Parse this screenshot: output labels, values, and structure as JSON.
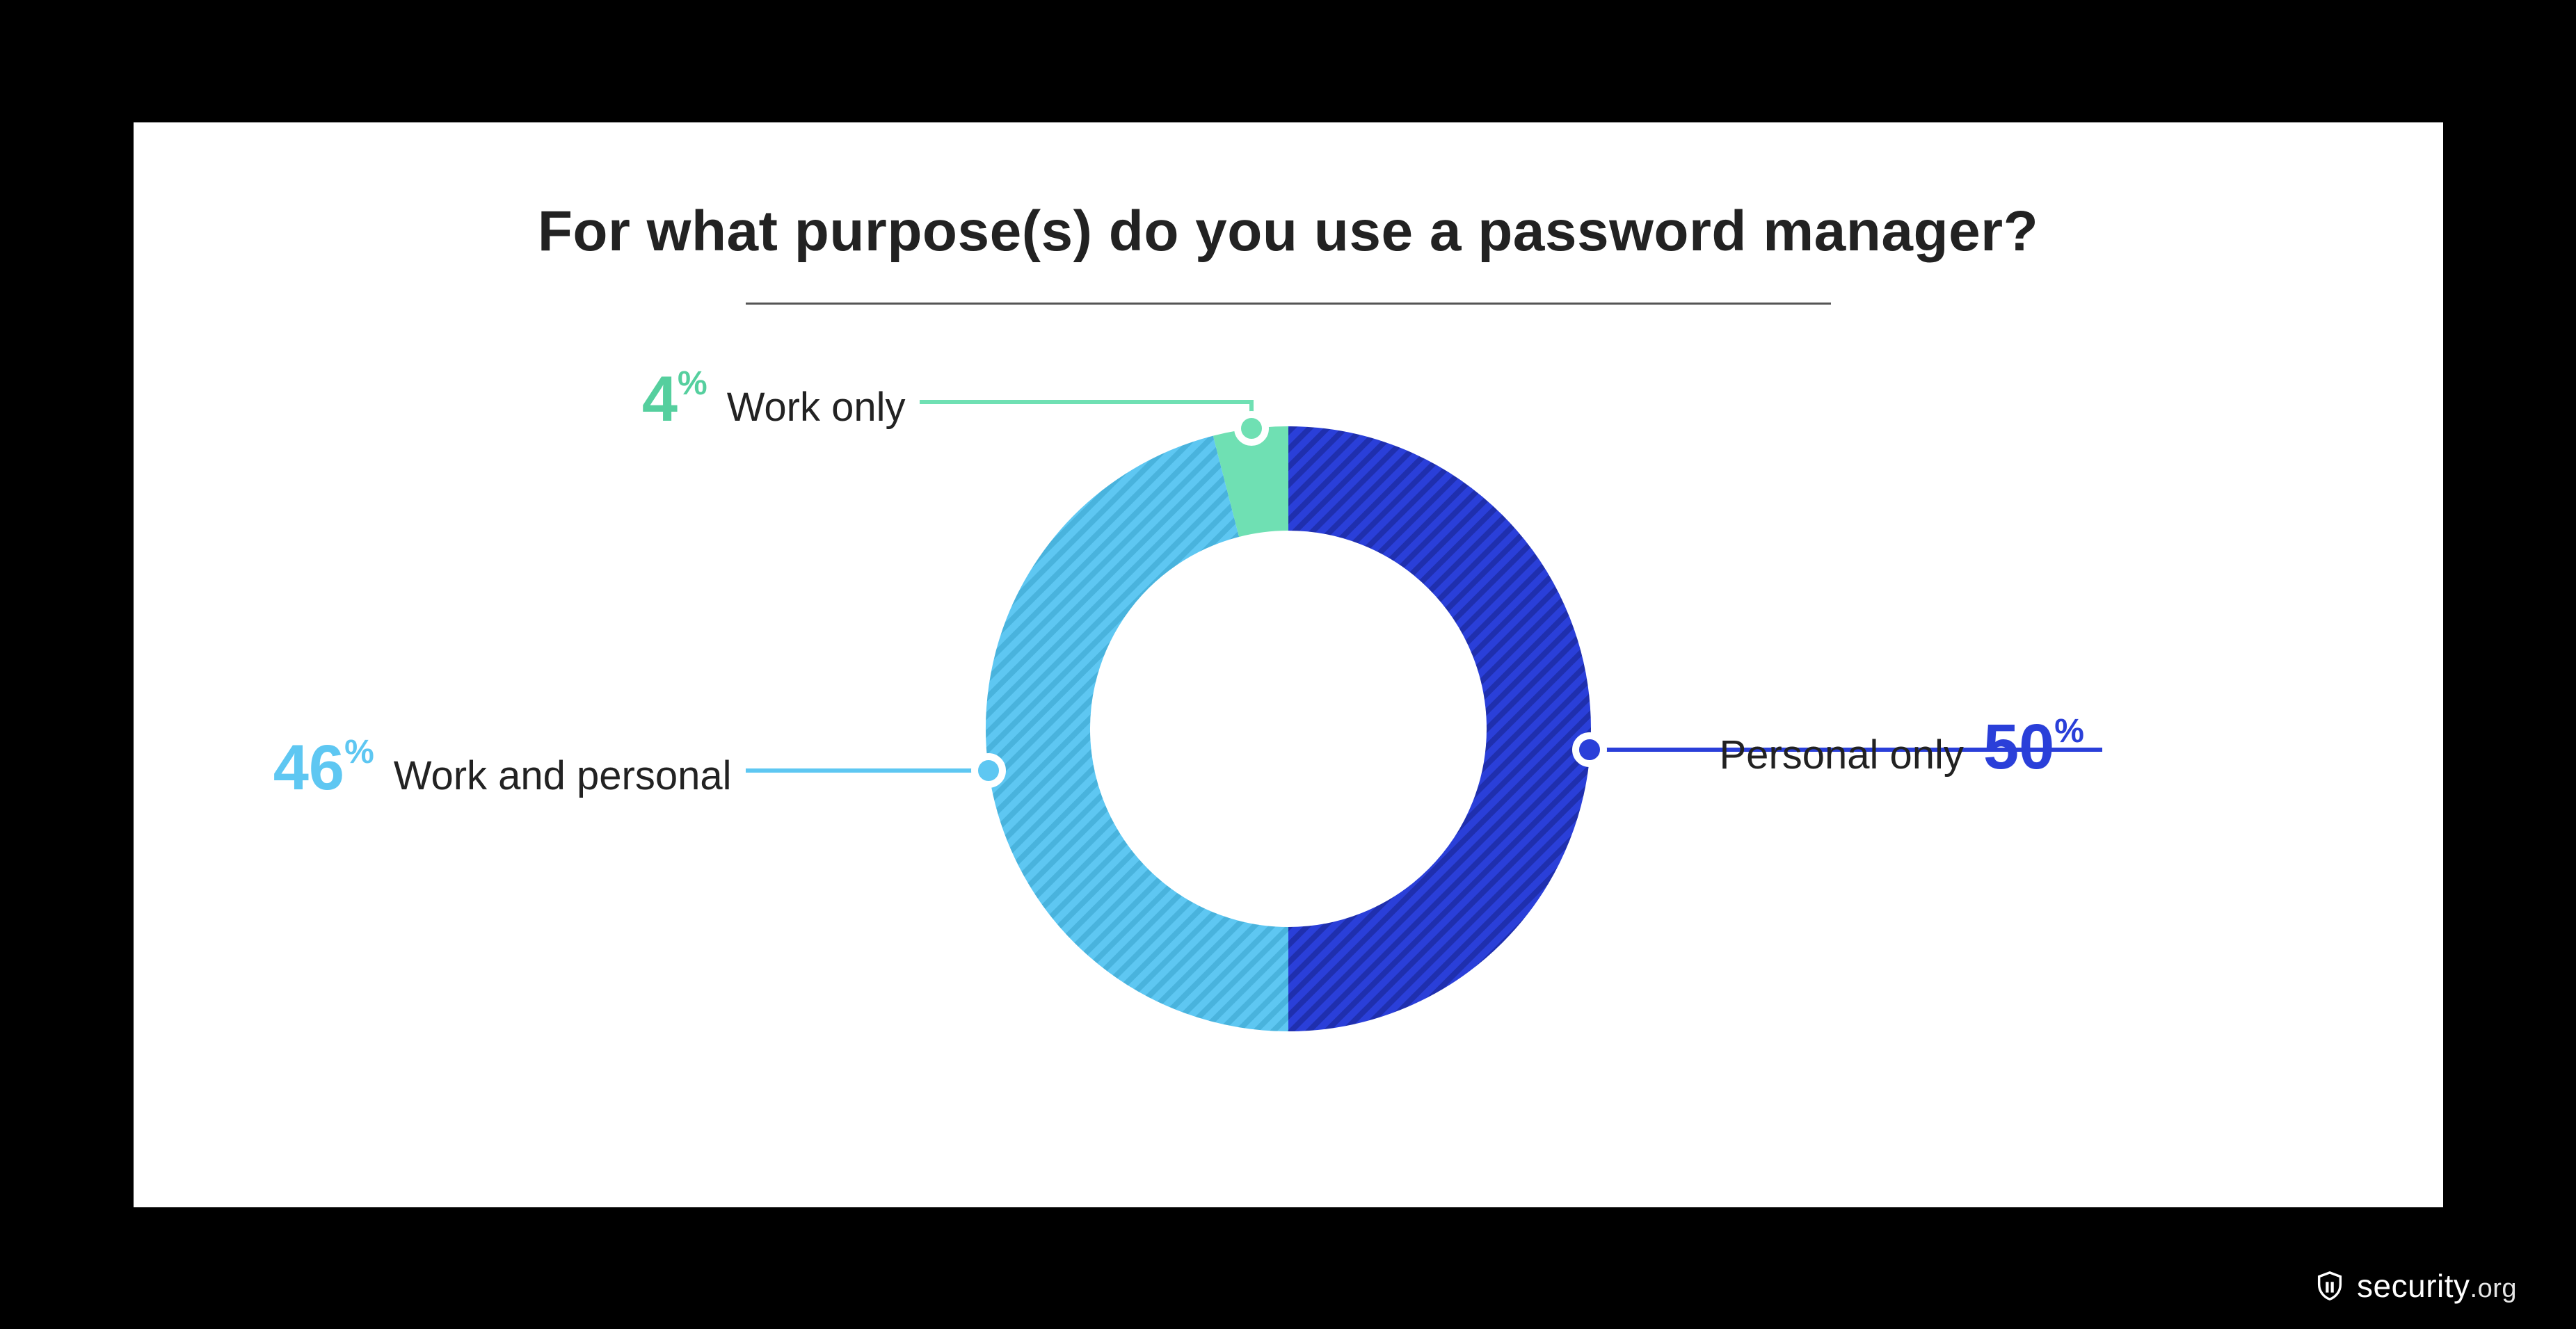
{
  "title": "For what purpose(s) do you use a password manager?",
  "chart_data": {
    "type": "pie",
    "title": "For what purpose(s) do you use a password manager?",
    "series": [
      {
        "name": "Personal only",
        "value": 50,
        "color": "#2a3fd9"
      },
      {
        "name": "Work and personal",
        "value": 46,
        "color": "#5ec7f2"
      },
      {
        "name": "Work only",
        "value": 4,
        "color": "#6fe0b3"
      }
    ]
  },
  "labels": {
    "personal_only": {
      "pct": "50",
      "text": "Personal only"
    },
    "work_and_personal": {
      "pct": "46",
      "text": "Work and personal"
    },
    "work_only": {
      "pct": "4",
      "text": "Work only"
    }
  },
  "percent_sign": "%",
  "brand": {
    "name": "security",
    "suffix": ".org"
  },
  "colors": {
    "personal_only": "#2a3fd9",
    "work_and_personal": "#5ec7f2",
    "work_only": "#6fe0b3",
    "personal_only_hatch": "#1f2fae",
    "work_and_personal_hatch": "#49b3dd"
  }
}
